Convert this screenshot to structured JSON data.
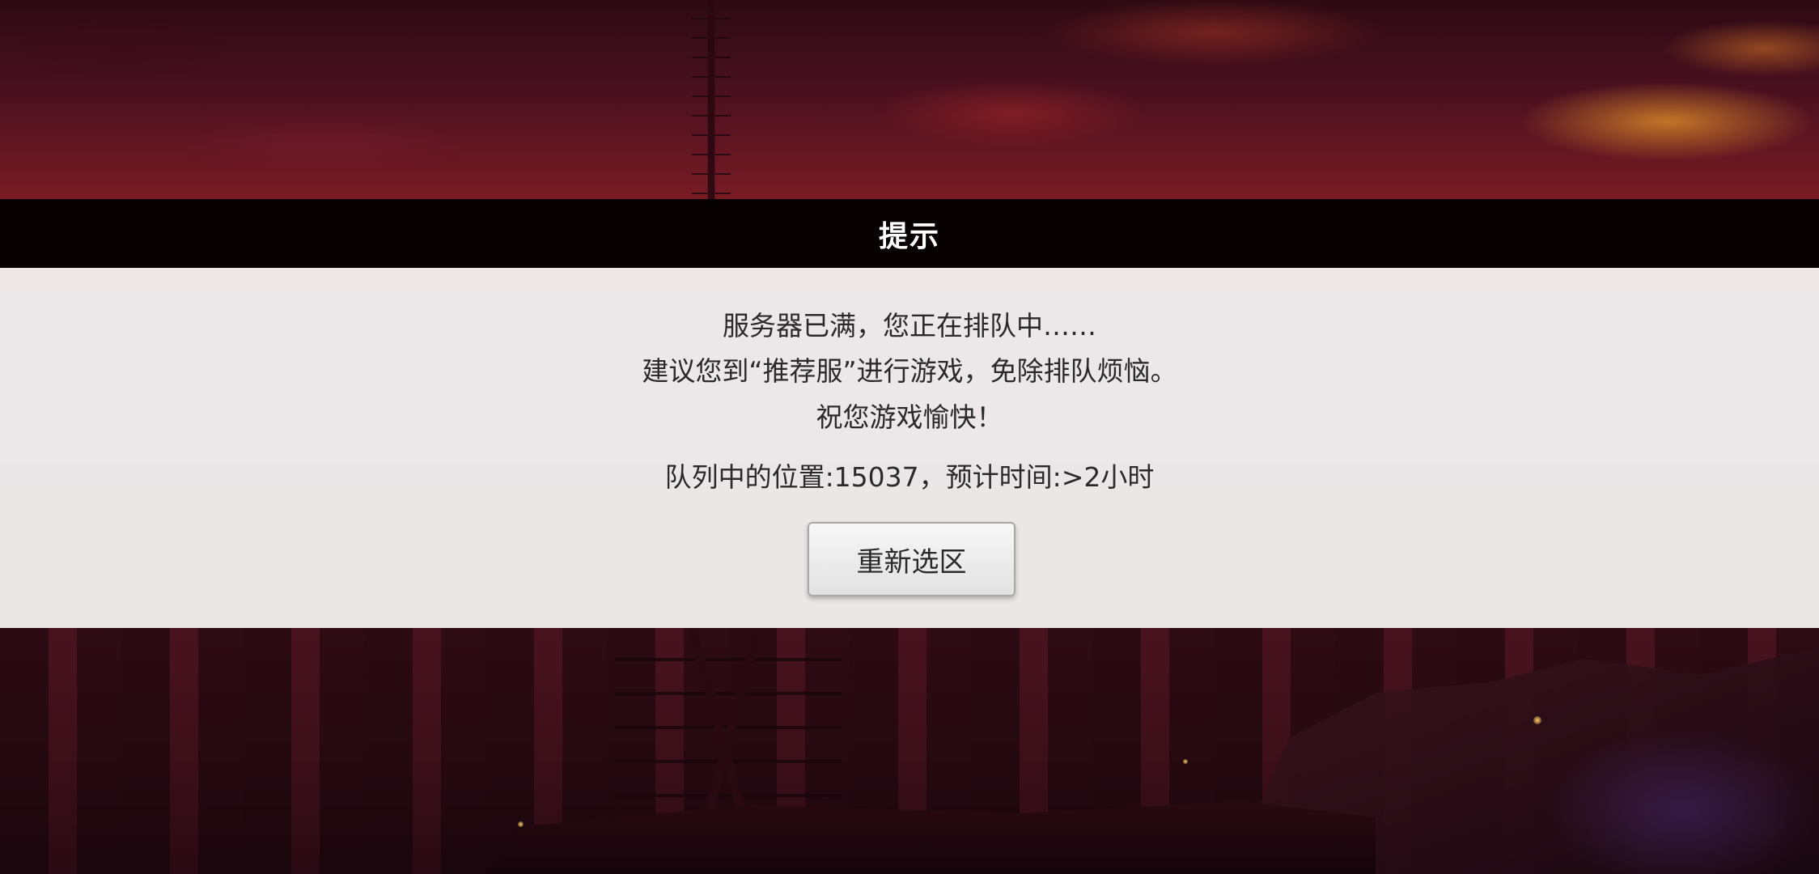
{
  "dialog": {
    "title": "提示",
    "message_line1": "服务器已满，您正在排队中……",
    "message_line2": "建议您到“推荐服”进行游戏，免除排队烦恼。",
    "message_line3": "祝您游戏愉快！",
    "queue_info": "队列中的位置:15037，预计时间:>2小时",
    "reselect_button": "重新选区"
  },
  "colors": {
    "title_bar": "#000000",
    "panel": "#f2f0f0",
    "text": "#2a2a2a",
    "background_accent": "#6b1a22"
  }
}
